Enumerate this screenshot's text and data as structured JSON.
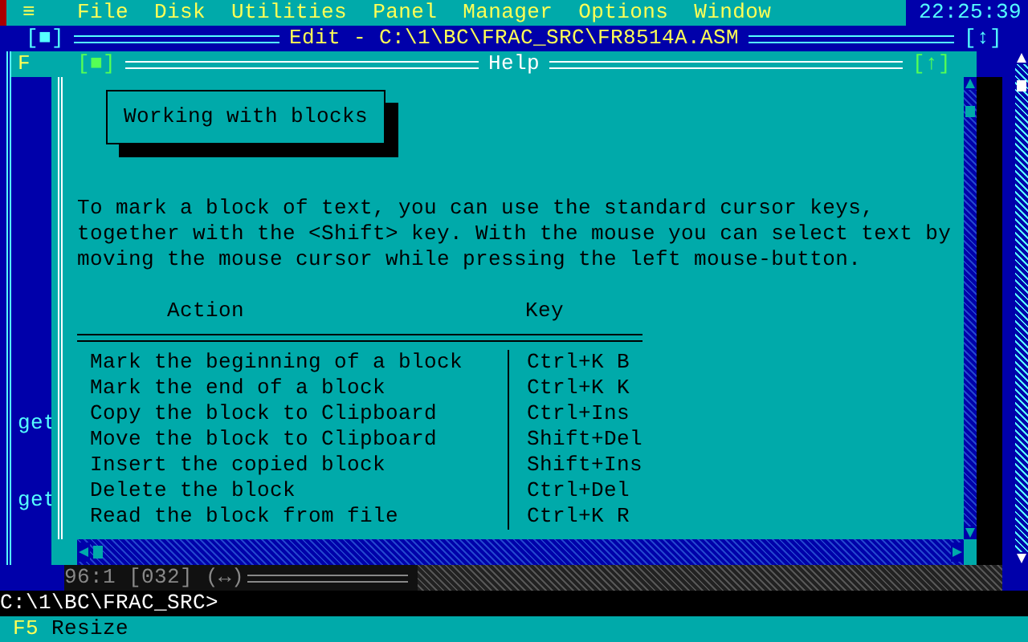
{
  "menu_bar": {
    "system_menu": "≡",
    "items": [
      {
        "label": "File"
      },
      {
        "label": "Disk"
      },
      {
        "label": "Utilities"
      },
      {
        "label": "Panel"
      },
      {
        "label": "Manager"
      },
      {
        "label": "Options"
      },
      {
        "label": "Window"
      }
    ],
    "clock": "22:25:39"
  },
  "editor_window": {
    "title": "Edit - C:\\1\\BC\\FRAC_SRC\\FR8514A.ASM",
    "close_box": "[■]",
    "zoom_box": "[↕]",
    "lines": [
      {
        "text": "F",
        "kind": "highlighted"
      },
      {
        "text": "get",
        "kind": "plain"
      },
      {
        "text": "get",
        "kind": "plain"
      }
    ],
    "status": "96:1 [032] (↔)"
  },
  "help_window": {
    "title": "Help",
    "close_box": "[■]",
    "zoom_box": "[↑]",
    "heading": "Working with blocks",
    "paragraph": [
      "To mark a block of text, you can use the standard cursor keys,",
      "together with the <Shift> key. With the mouse you can select text by",
      "moving the mouse cursor while pressing the left mouse-button."
    ],
    "table": {
      "columns": [
        "Action",
        "Key"
      ],
      "rows": [
        [
          "Mark the beginning of a block",
          "Ctrl+K B"
        ],
        [
          "Mark the end of a block",
          "Ctrl+K K"
        ],
        [
          "Copy the block to Clipboard",
          "Ctrl+Ins"
        ],
        [
          "Move the block to Clipboard",
          "Shift+Del"
        ],
        [
          "Insert the copied block",
          "Shift+Ins"
        ],
        [
          "Delete the block",
          "Ctrl+Del"
        ],
        [
          "Read the block from file",
          "Ctrl+K R"
        ]
      ]
    }
  },
  "prompt": "C:\\1\\BC\\FRAC_SRC>",
  "function_keys": [
    {
      "key": "F5",
      "label": "Resize"
    }
  ]
}
